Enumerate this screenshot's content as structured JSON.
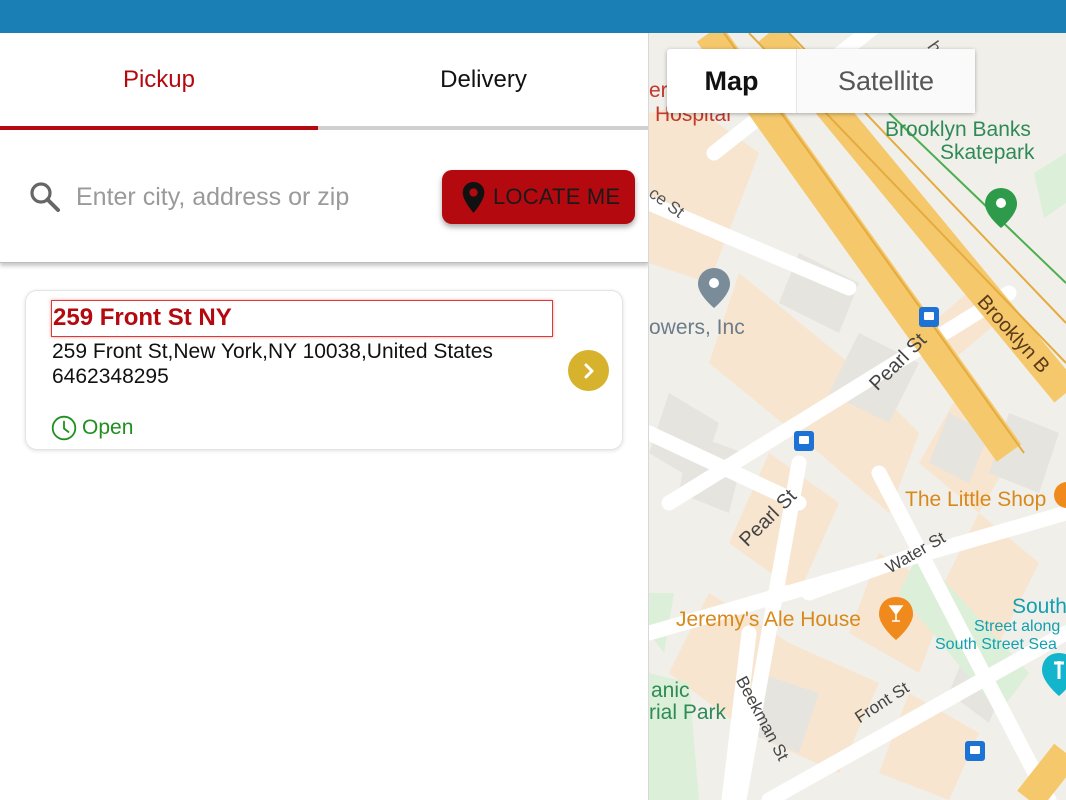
{
  "tabs": {
    "pickup": "Pickup",
    "delivery": "Delivery"
  },
  "search": {
    "placeholder": "Enter city, address or zip",
    "locate_label": "LOCATE ME"
  },
  "store": {
    "name": "259 Front St NY",
    "address": "259 Front St,New York,NY 10038,United States",
    "phone": "6462348295",
    "status": "Open"
  },
  "map": {
    "toggle": {
      "map": "Map",
      "satellite": "Satellite"
    },
    "labels": {
      "hospital": "Hospital",
      "brooklyn_banks": "Brooklyn Banks",
      "skatepark": "Skatepark",
      "towers": "owers, Inc",
      "pearl_st": "Pearl St",
      "little_shop": "The Little Shop",
      "water_st": "Water St",
      "jeremys": "Jeremy's Ale House",
      "south": "South",
      "street_along": "Street along",
      "south_street_sea": "South Street Sea",
      "anic": "anic",
      "rial_park": "rial Park",
      "beekman_st": "Beekman St",
      "front_st": "Front St",
      "brooklyn": "Brooklyn B",
      "ce_st": "ce St",
      "er": "er",
      "he": "he"
    }
  },
  "colors": {
    "accent": "#b50910",
    "topbar": "#1a7fb4",
    "open": "#1f8f1f",
    "chevron": "#d6b22d"
  }
}
